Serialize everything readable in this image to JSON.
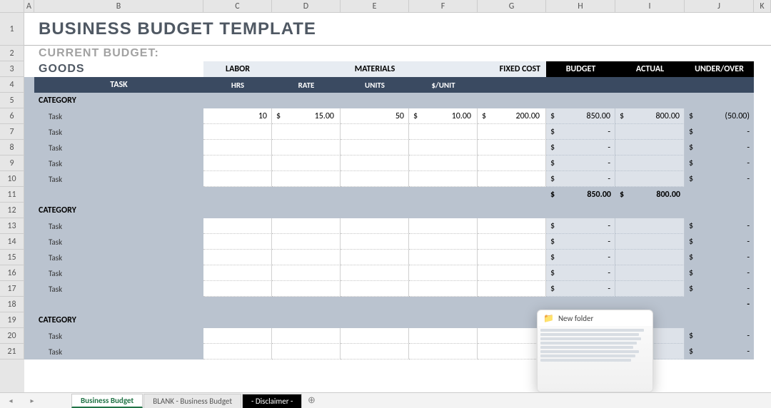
{
  "columns": [
    "A",
    "B",
    "C",
    "D",
    "E",
    "F",
    "G",
    "H",
    "I",
    "J",
    "K"
  ],
  "row_numbers": [
    1,
    2,
    3,
    4,
    5,
    6,
    7,
    8,
    9,
    10,
    11,
    12,
    13,
    14,
    15,
    16,
    17,
    18,
    19,
    20,
    21
  ],
  "title": "BUSINESS BUDGET TEMPLATE",
  "subtitle1": "CURRENT BUDGET:",
  "subtitle2": "GOODS",
  "section_headers": {
    "labor": "LABOR",
    "materials": "MATERIALS",
    "fixed_cost": "FIXED COST",
    "budget": "BUDGET",
    "actual": "ACTUAL",
    "under_over": "UNDER/OVER"
  },
  "sub_headers": {
    "task": "TASK",
    "hrs": "HRS",
    "rate": "RATE",
    "units": "UNITS",
    "per_unit": "$/UNIT"
  },
  "currency": "$",
  "dash": "-",
  "category_label": "CATEGORY",
  "task_label": "Task",
  "rows": {
    "r6": {
      "hrs": "10",
      "rate": "15.00",
      "units": "50",
      "per_unit": "10.00",
      "fixed": "200.00",
      "budget": "850.00",
      "actual": "800.00",
      "uo": "(50.00)"
    },
    "totals": {
      "budget": "850.00",
      "actual": "800.00"
    }
  },
  "sheet_tabs": [
    "Business Budget",
    "BLANK - Business Budget",
    "- Disclaimer -"
  ],
  "popup": {
    "title": "New folder"
  },
  "add_tab": "⊕",
  "nav_prev": "◂",
  "nav_next": "▸"
}
